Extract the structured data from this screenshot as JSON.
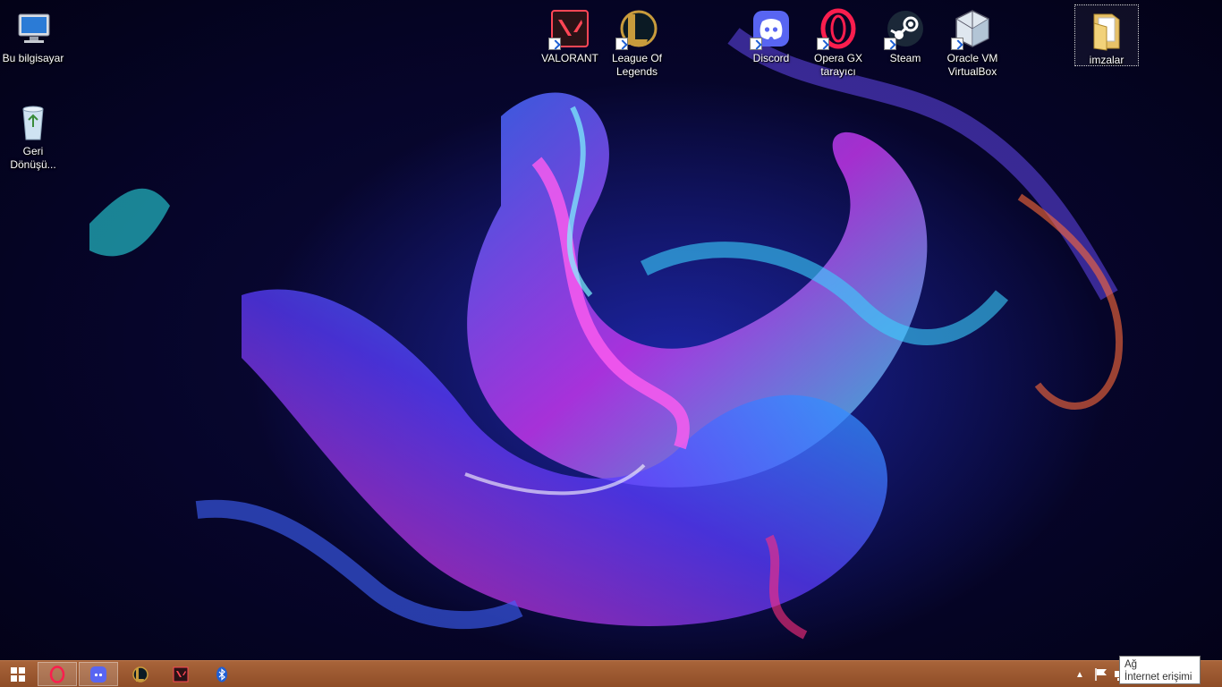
{
  "desktop": {
    "icons": [
      {
        "label": "Bu bilgisayar",
        "icon": "computer-icon"
      },
      {
        "label": "Geri Dönüşü...",
        "icon": "recycle-bin-icon"
      },
      {
        "label": "VALORANT",
        "icon": "valorant-icon"
      },
      {
        "label": "League Of Legends",
        "icon": "league-of-legends-icon"
      },
      {
        "label": "Discord",
        "icon": "discord-icon"
      },
      {
        "label": "Opera GX tarayıcı",
        "icon": "opera-gx-icon"
      },
      {
        "label": "Steam",
        "icon": "steam-icon"
      },
      {
        "label": "Oracle VM VirtualBox",
        "icon": "virtualbox-icon"
      },
      {
        "label": "imzalar",
        "icon": "folder-icon"
      }
    ]
  },
  "taskbar": {
    "start_icon": "windows-start-icon",
    "pinned": [
      "opera-gx-icon",
      "discord-icon",
      "league-of-legends-icon",
      "valorant-icon",
      "bluetooth-icon"
    ],
    "tray": [
      "show-hidden-icons-icon",
      "action-center-flag-icon",
      "network-icon"
    ]
  },
  "tooltip": {
    "title": "Ağ",
    "status": "İnternet erişimi"
  },
  "colors": {
    "taskbar": "#9a5730",
    "valorant": "#ff4655",
    "discord": "#5865f2",
    "opera": "#fa1e4e",
    "steam": "#1b2838",
    "league": "#c89b3c"
  }
}
